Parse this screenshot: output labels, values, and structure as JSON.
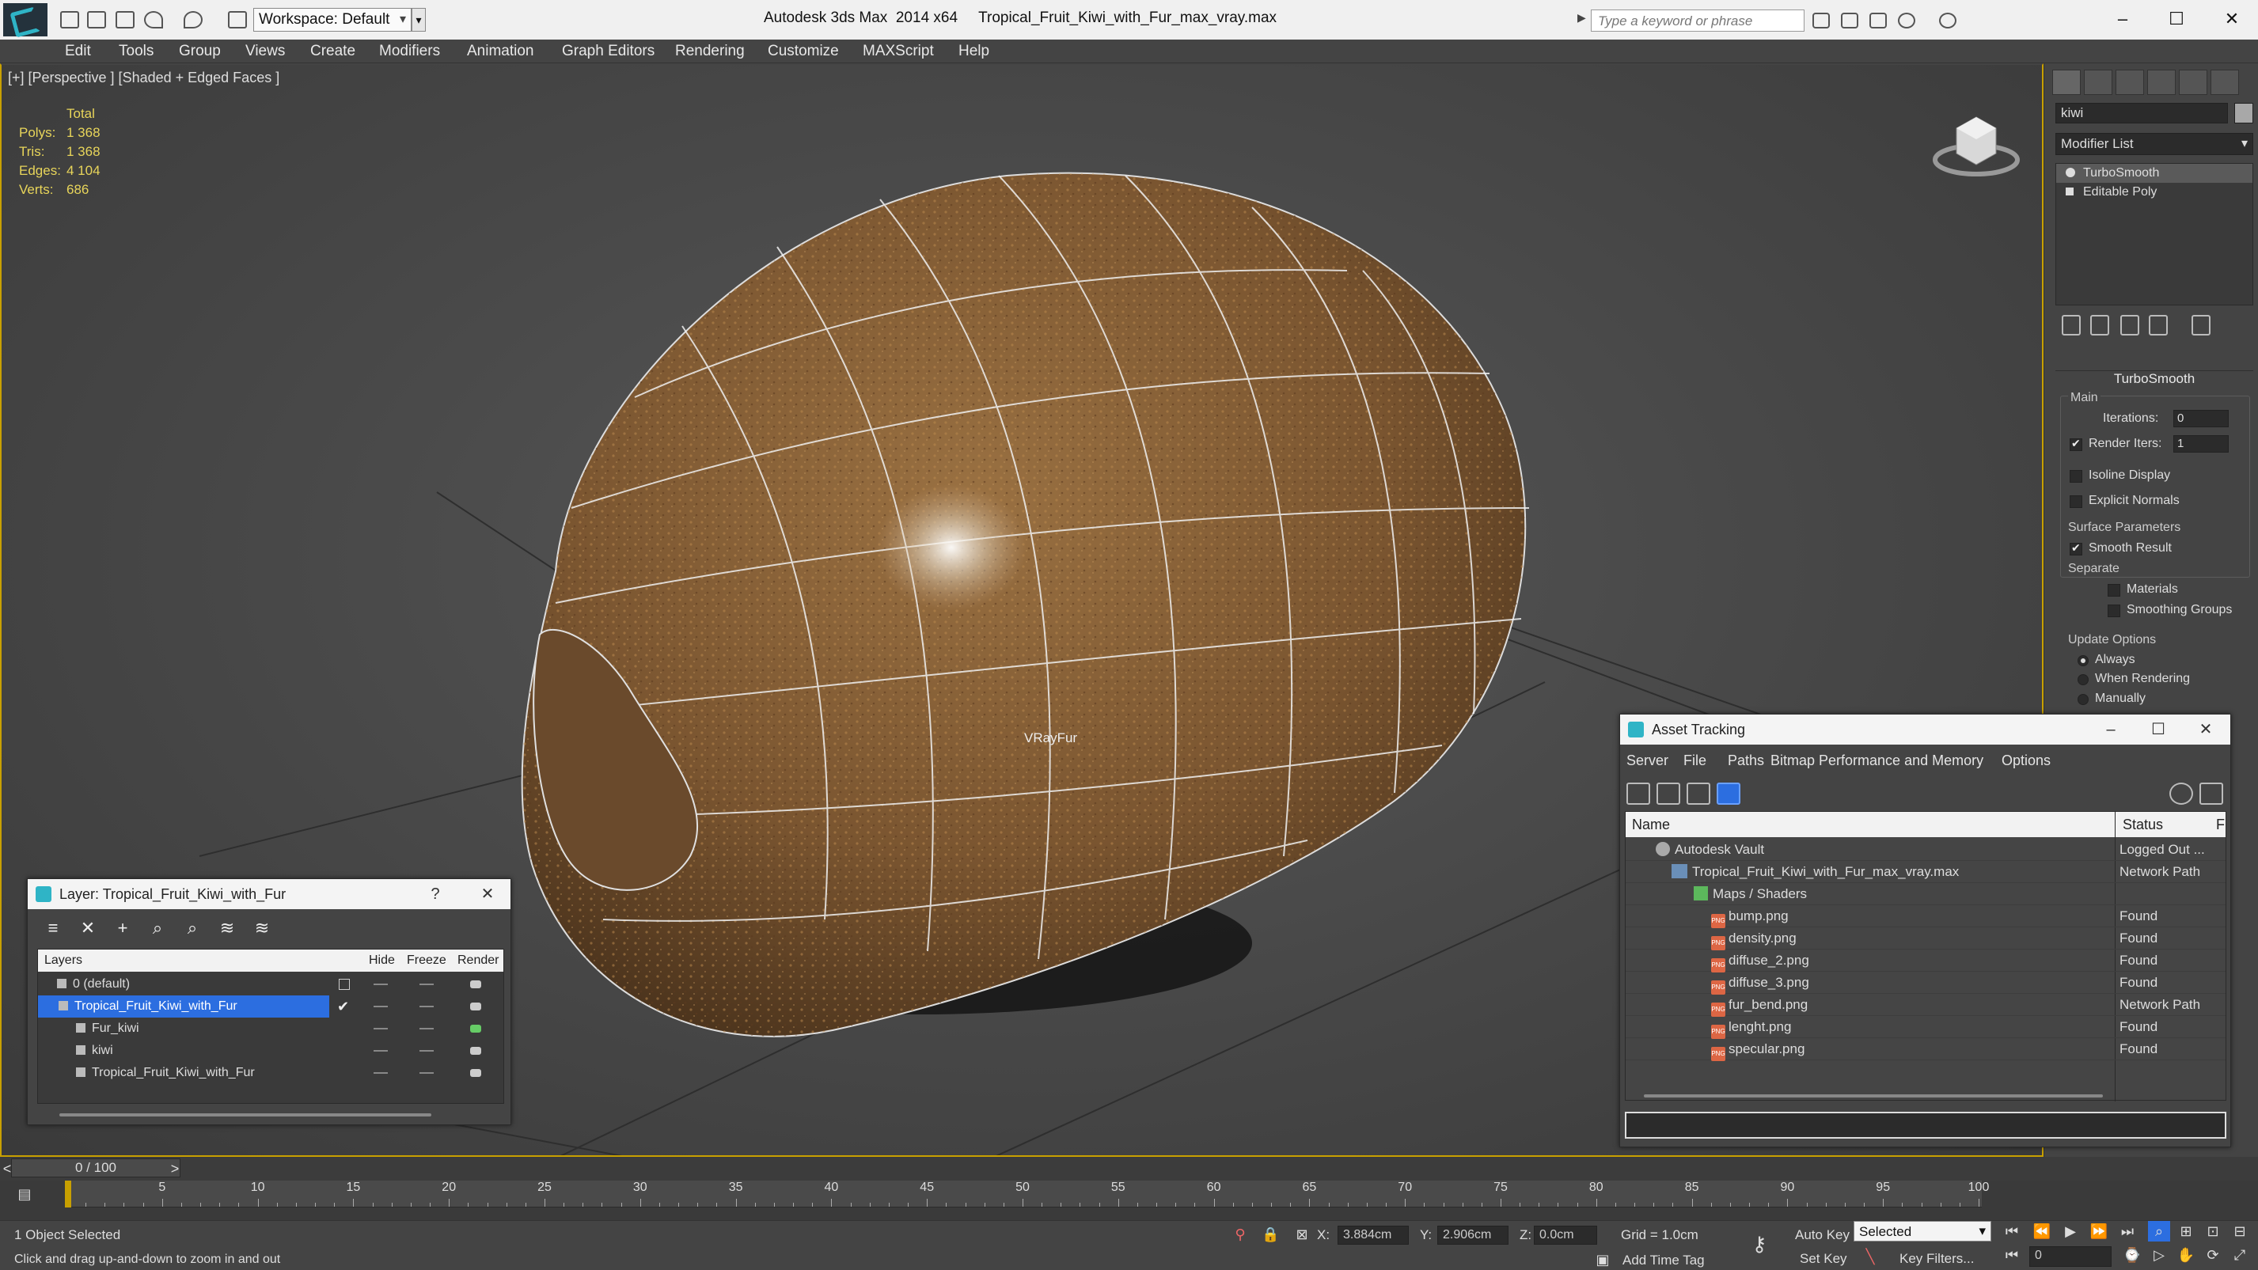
{
  "app": {
    "title": "Autodesk 3ds Max  2014 x64     Tropical_Fruit_Kiwi_with_Fur_max_vray.max",
    "workspace": "Workspace: Default",
    "search_placeholder": "Type a keyword or phrase"
  },
  "menu": [
    "Edit",
    "Tools",
    "Group",
    "Views",
    "Create",
    "Modifiers",
    "Animation",
    "Graph Editors",
    "Rendering",
    "Customize",
    "MAXScript",
    "Help"
  ],
  "viewport": {
    "label": "[+] [Perspective ] [Shaded + Edged Faces ]",
    "stats": {
      "header": "Total",
      "rows": [
        {
          "k": "Polys:",
          "v": "1 368"
        },
        {
          "k": "Tris:",
          "v": "1 368"
        },
        {
          "k": "Edges:",
          "v": "4 104"
        },
        {
          "k": "Verts:",
          "v": "686"
        }
      ]
    },
    "object_label": "VRayFur"
  },
  "command_panel": {
    "object_name": "kiwi",
    "modifier_list": "Modifier List",
    "stack": [
      "TurboSmooth",
      "Editable Poly"
    ],
    "rollout": "TurboSmooth",
    "main_group": "Main",
    "iterations_label": "Iterations:",
    "iterations_value": "0",
    "render_iters_label": "Render Iters:",
    "render_iters_value": "1",
    "isoline": "Isoline Display",
    "explicit_normals": "Explicit Normals",
    "surface_params": "Surface Parameters",
    "smooth_result": "Smooth Result",
    "separate": "Separate",
    "materials": "Materials",
    "smoothing_groups": "Smoothing Groups",
    "update_options": "Update Options",
    "always": "Always",
    "when_rendering": "When Rendering",
    "manually": "Manually"
  },
  "layer_dialog": {
    "title": "Layer: Tropical_Fruit_Kiwi_with_Fur",
    "help": "?",
    "columns": {
      "layers": "Layers",
      "hide": "Hide",
      "freeze": "Freeze",
      "render": "Render"
    },
    "rows": [
      {
        "name": "0 (default)"
      },
      {
        "name": "Tropical_Fruit_Kiwi_with_Fur"
      },
      {
        "name": "Fur_kiwi"
      },
      {
        "name": "kiwi"
      },
      {
        "name": "Tropical_Fruit_Kiwi_with_Fur"
      }
    ]
  },
  "asset_dialog": {
    "title": "Asset Tracking",
    "menu": [
      "Server",
      "File",
      "Paths",
      "Bitmap Performance and Memory",
      "Options"
    ],
    "columns": {
      "name": "Name",
      "status": "Status",
      "extra": "F"
    },
    "rows": [
      {
        "name": "Autodesk Vault",
        "status": "Logged Out ..."
      },
      {
        "name": "Tropical_Fruit_Kiwi_with_Fur_max_vray.max",
        "status": "Network Path"
      },
      {
        "name": "Maps / Shaders",
        "status": ""
      },
      {
        "name": "bump.png",
        "status": "Found"
      },
      {
        "name": "density.png",
        "status": "Found"
      },
      {
        "name": "diffuse_2.png",
        "status": "Found"
      },
      {
        "name": "diffuse_3.png",
        "status": "Found"
      },
      {
        "name": "fur_bend.png",
        "status": "Network Path"
      },
      {
        "name": "lenght.png",
        "status": "Found"
      },
      {
        "name": "specular.png",
        "status": "Found"
      }
    ]
  },
  "timeline": {
    "frame": "0 / 100",
    "ticks": [
      "5",
      "10",
      "15",
      "20",
      "25",
      "30",
      "35",
      "40",
      "45",
      "50",
      "55",
      "60",
      "65",
      "70",
      "75",
      "80",
      "85",
      "90",
      "95",
      "100"
    ]
  },
  "status": {
    "selected": "1 Object Selected",
    "prompt": "Click and drag up-and-down to zoom in and out",
    "x_label": "X:",
    "x": "3.884cm",
    "y_label": "Y:",
    "y": "2.906cm",
    "z_label": "Z:",
    "z": "0.0cm",
    "grid": "Grid = 1.0cm",
    "auto_key": "Auto Key",
    "set_key": "Set Key",
    "key_mode": "Selected",
    "key_filters": "Key Filters...",
    "add_time_tag": "Add Time Tag",
    "frame_field": "0"
  },
  "colors": {
    "accent_blue": "#2c6ee0",
    "viewport_border": "#c8a000",
    "stats": "#e8d55a",
    "teal_logo": "#2fb4c6"
  }
}
